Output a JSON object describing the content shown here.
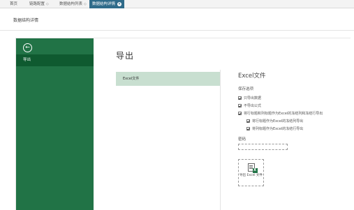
{
  "tabs": [
    {
      "label": "首页",
      "chevron": ""
    },
    {
      "label": "链路配置",
      "chevron": "◇"
    },
    {
      "label": "数据结构列表",
      "chevron": "◇"
    },
    {
      "label": "数据结构详情",
      "chevron": "◇",
      "active": true
    }
  ],
  "page": {
    "title": "数据结构详情"
  },
  "backstage": {
    "back_icon": "←",
    "nav_export": "导出",
    "heading": "导出",
    "format_item": "Excel文件",
    "options_title": "Excel文件",
    "options_group": "保存选项",
    "options": [
      {
        "label": "只导出数据",
        "checked": true
      },
      {
        "label": "不导出公式",
        "checked": true
      },
      {
        "label": "将行标题和列标题作为Excel的冻结列和冻结行导出",
        "checked": true
      },
      {
        "label": "将行标题作为Excel的冻结列导出",
        "checked": true
      },
      {
        "label": "将列标题作为Excel的冻结行导出",
        "checked": true
      }
    ],
    "password_label": "密码",
    "password_value": "",
    "export_button": "导出 Excel 文件"
  },
  "colors": {
    "accent": "#217346",
    "accent_dark": "#0f5a30",
    "selection": "#c8dfd0",
    "active_tab": "#2f6b8a"
  }
}
